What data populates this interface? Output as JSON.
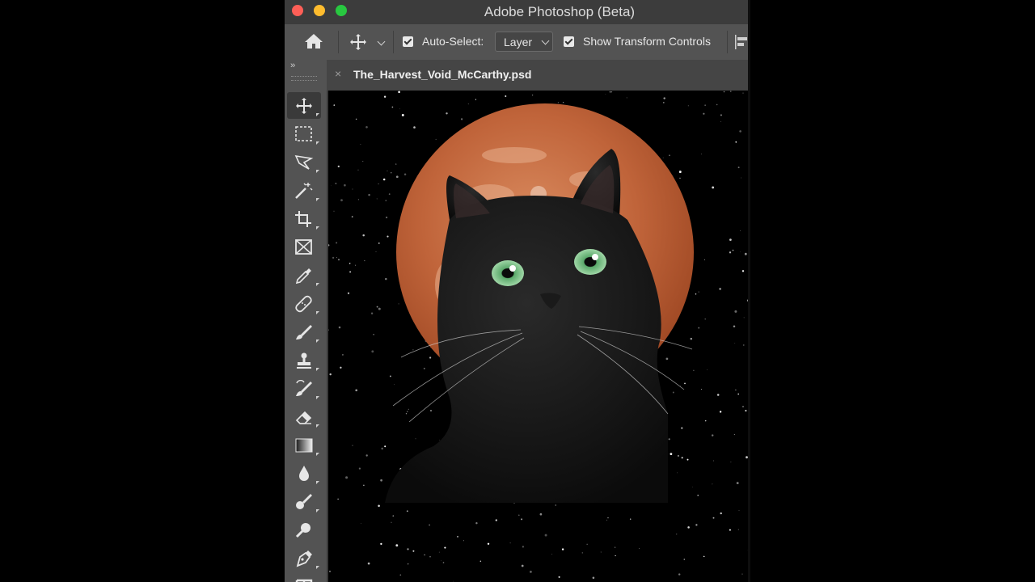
{
  "window": {
    "title": "Adobe Photoshop (Beta)"
  },
  "options_bar": {
    "auto_select_label": "Auto-Select:",
    "auto_select_checked": true,
    "layer_dropdown_value": "Layer",
    "show_transform_label": "Show Transform Controls",
    "show_transform_checked": true
  },
  "document": {
    "tab_name": "The_Harvest_Void_McCarthy.psd",
    "close_glyph": "×"
  },
  "toolbar": {
    "collapse_glyph": "››",
    "tools": [
      "move-tool",
      "marquee-tool",
      "lasso-tool",
      "magic-wand-tool",
      "crop-tool",
      "frame-tool",
      "eyedropper-tool",
      "healing-brush-tool",
      "brush-tool",
      "clone-stamp-tool",
      "history-brush-tool",
      "eraser-tool",
      "gradient-tool",
      "blur-tool",
      "dodge-tool",
      "zoom-tool",
      "pen-tool",
      "type-tool"
    ],
    "active_tool": "move-tool"
  },
  "colors": {
    "ui_dark": "#535353",
    "titlebar": "#3c3c3c",
    "moon": "#c0643a",
    "cat_eye": "#7fc48a"
  }
}
